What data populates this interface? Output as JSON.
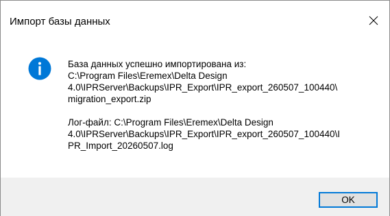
{
  "window": {
    "title": "Импорт базы данных",
    "close_icon": "close-icon"
  },
  "message": {
    "icon": "info-icon",
    "icon_color": "#0078d7",
    "line1": "База данных успешно импортирована из:\nC:\\Program Files\\Eremex\\Delta Design\n4.0\\IPRServer\\Backups\\IPR_Export\\IPR_export_260507_100440\\\nmigration_export.zip",
    "line2": "Лог-файл: C:\\Program Files\\Eremex\\Delta Design\n4.0\\IPRServer\\Backups\\IPR_Export\\IPR_export_260507_100440\\I\nPR_Import_20260507.log"
  },
  "buttons": {
    "ok_label": "OK"
  },
  "colors": {
    "accent": "#0078d7",
    "footer_bg": "#f0f0f0",
    "button_bg": "#e1e1e1"
  }
}
